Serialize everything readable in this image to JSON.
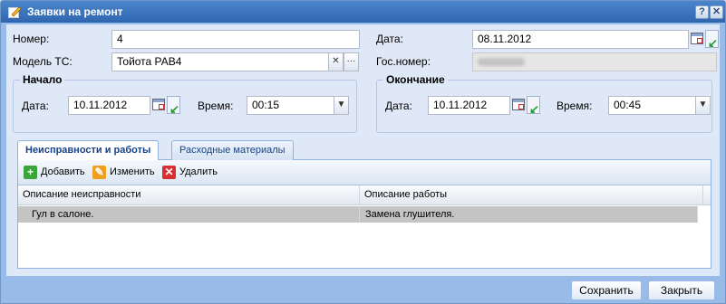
{
  "window": {
    "title": "Заявки на ремонт",
    "help_glyph": "?",
    "close_glyph": "✕",
    "icon": "pencil-note-icon"
  },
  "form": {
    "number_label": "Номер:",
    "number_value": "4",
    "model_label": "Модель ТС:",
    "model_value": "Тойота РАВ4",
    "model_clear_glyph": "✕",
    "model_more_glyph": "···",
    "date_label": "Дата:",
    "date_value": "08.11.2012",
    "plate_label": "Гос.номер:",
    "start": {
      "legend": "Начало",
      "date_label": "Дата:",
      "date_value": "10.11.2012",
      "time_label": "Время:",
      "time_value": "00:15"
    },
    "end": {
      "legend": "Окончание",
      "date_label": "Дата:",
      "date_value": "10.11.2012",
      "time_label": "Время:",
      "time_value": "00:45"
    }
  },
  "tabs": [
    {
      "label": "Неисправности и работы",
      "active": true
    },
    {
      "label": "Расходные материалы",
      "active": false
    }
  ],
  "toolbar": {
    "add_label": "Добавить",
    "edit_label": "Изменить",
    "delete_label": "Удалить",
    "add_glyph": "+",
    "edit_glyph": "✎",
    "delete_glyph": "✕"
  },
  "grid": {
    "columns": [
      "Описание неисправности",
      "Описание работы"
    ],
    "rows": [
      {
        "fault": "Гул в салоне.",
        "work": "Замена глушителя.",
        "selected": true
      }
    ]
  },
  "footer": {
    "save_label": "Сохранить",
    "close_label": "Закрыть"
  },
  "colors": {
    "title_bar": "#3a73bd",
    "window_bg": "#dfe8f6",
    "selected_row": "#c4c4c4",
    "add_icon": "#3aa53a",
    "edit_icon": "#f0a020",
    "delete_icon": "#d83030"
  }
}
